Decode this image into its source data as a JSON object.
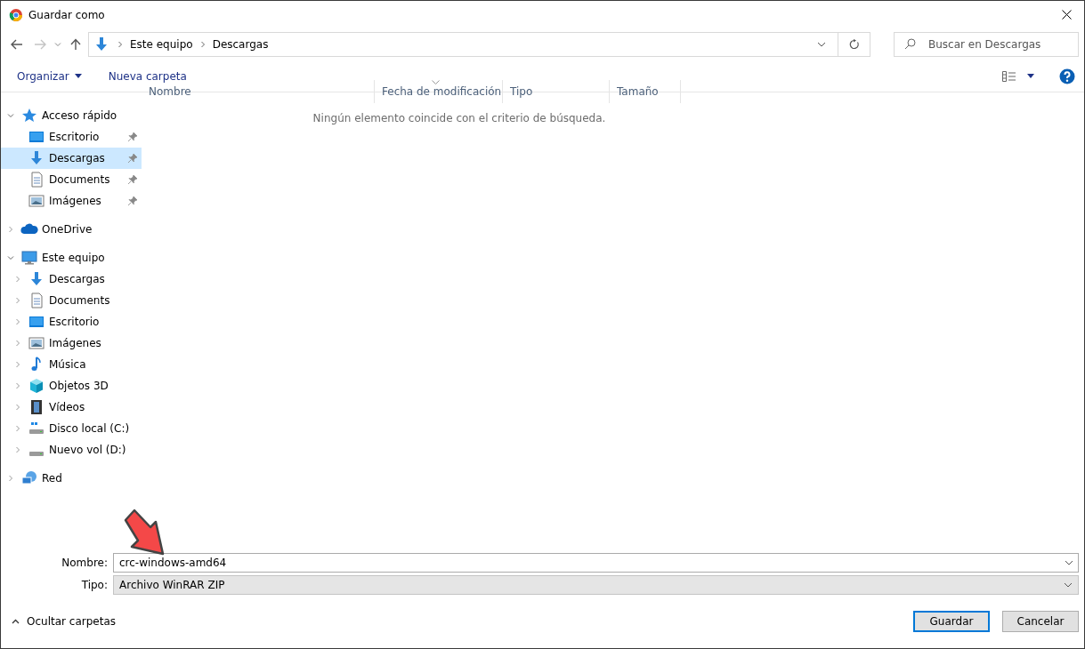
{
  "window": {
    "title": "Guardar como"
  },
  "address_bar": {
    "path": [
      "Este equipo",
      "Descargas"
    ]
  },
  "search": {
    "placeholder": "Buscar en Descargas"
  },
  "toolbar": {
    "organize": "Organizar",
    "new_folder": "Nueva carpeta"
  },
  "navigation": [
    {
      "label": "Acceso rápido",
      "kind": "quick",
      "expanded": true,
      "selected": false,
      "children": [
        {
          "label": "Escritorio",
          "kind": "desktop",
          "pinned": true,
          "selected": false
        },
        {
          "label": "Descargas",
          "kind": "downloads",
          "pinned": true,
          "selected": true
        },
        {
          "label": "Documents",
          "kind": "documents",
          "pinned": true,
          "selected": false
        },
        {
          "label": "Imágenes",
          "kind": "pictures",
          "pinned": true,
          "selected": false
        }
      ]
    },
    {
      "label": "OneDrive",
      "kind": "cloud",
      "expanded": false,
      "selected": false
    },
    {
      "label": "Este equipo",
      "kind": "pc",
      "expanded": true,
      "selected": false,
      "children": [
        {
          "label": "Descargas",
          "kind": "downloads",
          "expanded": false,
          "selected": false
        },
        {
          "label": "Documents",
          "kind": "documents",
          "expanded": false,
          "selected": false
        },
        {
          "label": "Escritorio",
          "kind": "desktop",
          "expanded": false,
          "selected": false
        },
        {
          "label": "Imágenes",
          "kind": "pictures",
          "expanded": false,
          "selected": false
        },
        {
          "label": "Música",
          "kind": "music",
          "expanded": false,
          "selected": false
        },
        {
          "label": "Objetos 3D",
          "kind": "objects3d",
          "expanded": false,
          "selected": false
        },
        {
          "label": "Vídeos",
          "kind": "videos",
          "expanded": false,
          "selected": false
        },
        {
          "label": "Disco local (C:)",
          "kind": "system_drive",
          "expanded": false,
          "selected": false
        },
        {
          "label": "Nuevo vol (D:)",
          "kind": "drive",
          "expanded": false,
          "selected": false
        }
      ]
    },
    {
      "label": "Red",
      "kind": "network",
      "expanded": false,
      "selected": false
    }
  ],
  "table": {
    "columns": [
      {
        "label": "Nombre",
        "sorted": false
      },
      {
        "label": "Fecha de modificación",
        "sorted": true
      },
      {
        "label": "Tipo",
        "sorted": false
      },
      {
        "label": "Tamaño",
        "sorted": false
      }
    ],
    "empty_message": "Ningún elemento coincide con el criterio de búsqueda."
  },
  "form": {
    "name_label": "Nombre:",
    "name_value": "crc-windows-amd64",
    "type_label": "Tipo:",
    "type_value": "Archivo WinRAR ZIP"
  },
  "footer": {
    "toggle": "Ocultar carpetas",
    "buttons": [
      {
        "label": "Guardar",
        "default": true
      },
      {
        "label": "Cancelar",
        "default": false
      }
    ]
  }
}
